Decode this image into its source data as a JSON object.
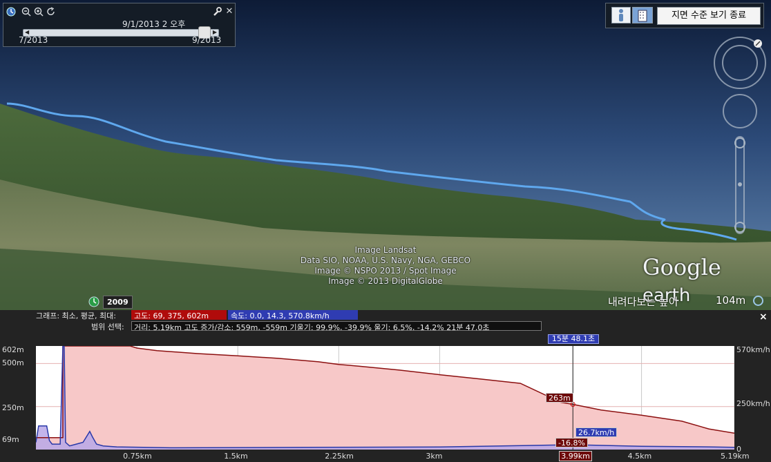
{
  "time_slider": {
    "current_date": "9/1/2013   2 오후",
    "start_label": "7/2013",
    "end_label": "9/2013",
    "icons": [
      "clock-icon",
      "zoom-out-icon",
      "zoom-in-icon",
      "refresh-icon",
      "wrench-icon",
      "close-icon"
    ]
  },
  "view_toolbar": {
    "exit_label": "지면 수준 보기 종료",
    "icons": [
      "person-icon",
      "building-icon"
    ]
  },
  "imagery_credits": [
    "Image Landsat",
    "Data SIO, NOAA, U.S. Navy, NGA, GEBCO",
    "Image © NSPO 2013 / Spot Image",
    "Image © 2013 DigitalGlobe"
  ],
  "brand": {
    "google": "Google",
    "earth": "earth"
  },
  "historical_year": "2009",
  "eye_altitude": {
    "label": "내려다보는 높이",
    "value": "104m"
  },
  "profile_panel": {
    "graph_label": "그래프: 최소, 평균, 최대:",
    "elevation_badge": "고도: 69, 375, 602m",
    "speed_badge": "속도: 0.0, 14.3, 570.8km/h",
    "range_label": "범위 선택:",
    "stats": "거리: 5.19km 고도 증가/감소: 559m, -559m 기울기: 99.9%, -39.9% 울기: 6.5%, -14.2% 21분 47.0초",
    "close_label": "×",
    "cursor_time": "15분 48.1초",
    "cursor_elevation": "263m",
    "cursor_speed": "26.7km/h",
    "cursor_slope": "-16.8%",
    "cursor_distance": "3.99km"
  },
  "chart_data": {
    "type": "area",
    "x_ticks": [
      "0.75km",
      "1.5km",
      "2.25km",
      "3km",
      "3.99km",
      "4.5km",
      "5.19km"
    ],
    "x_tick_values_km": [
      0.75,
      1.5,
      2.25,
      3.0,
      3.99,
      4.5,
      5.19
    ],
    "y_left_ticks": [
      "602m",
      "500m",
      "250m",
      "69m"
    ],
    "y_right_ticks": [
      "570km/h",
      "250km/h",
      "0"
    ],
    "xlim_km": [
      0,
      5.19
    ],
    "elevation_ylim_m": [
      0,
      602
    ],
    "speed_ylim_kmh": [
      0,
      570.8
    ],
    "cursor_x_km": 3.99,
    "series": [
      {
        "name": "고도",
        "color": "#8b0f0f",
        "fill": "#f7c8c8",
        "x": [
          0,
          0.15,
          0.2,
          0.2,
          0.35,
          0.7,
          0.75,
          0.9,
          1.2,
          1.5,
          1.8,
          2.1,
          2.25,
          2.4,
          2.7,
          3.0,
          3.3,
          3.6,
          3.9,
          3.99,
          4.2,
          4.5,
          4.8,
          5.0,
          5.19
        ],
        "values": [
          69,
          69,
          69,
          602,
          602,
          602,
          590,
          575,
          558,
          545,
          530,
          510,
          495,
          485,
          462,
          435,
          410,
          385,
          275,
          263,
          230,
          200,
          165,
          120,
          95
        ]
      },
      {
        "name": "속도",
        "color": "#2838a8",
        "fill": "#b8a8e8",
        "x": [
          0,
          0.02,
          0.08,
          0.1,
          0.12,
          0.18,
          0.2,
          0.21,
          0.22,
          0.25,
          0.3,
          0.35,
          0.4,
          0.42,
          0.45,
          0.5,
          0.6,
          1.0,
          2.0,
          3.0,
          3.99,
          4.5,
          5.0,
          5.19
        ],
        "values": [
          40,
          130,
          130,
          50,
          30,
          30,
          570,
          570,
          40,
          20,
          30,
          40,
          100,
          70,
          30,
          20,
          15,
          10,
          12,
          14,
          26.7,
          18,
          15,
          12
        ]
      }
    ]
  },
  "colors": {
    "elevation": "#8b0f0f",
    "speed": "#2f3cb2",
    "track": "#5fa8ee"
  }
}
